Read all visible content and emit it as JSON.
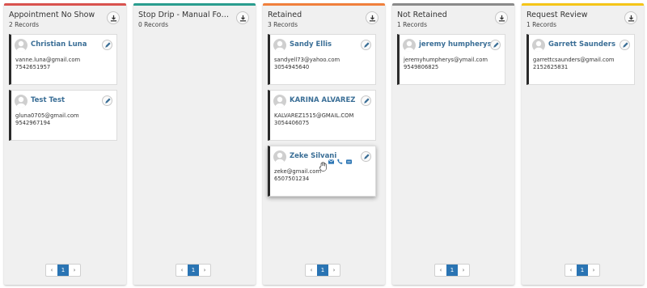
{
  "columns": [
    {
      "title": "Appointment No Show",
      "count": "2 Records",
      "color": "#d9534f",
      "cards": [
        {
          "name": "Christian Luna",
          "email": "vanne.luna@gmail.com",
          "phone": "7542651957"
        },
        {
          "name": "Test Test",
          "email": "gluna0705@gmail.com",
          "phone": "9542967194"
        }
      ],
      "pager": {
        "prev": "‹",
        "page": "1",
        "next": "›"
      }
    },
    {
      "title": "Stop Drip - Manual Follow ...",
      "count": "0 Records",
      "color": "#2a9d8f",
      "cards": [],
      "pager": {
        "prev": "‹",
        "page": "1",
        "next": "›"
      }
    },
    {
      "title": "Retained",
      "count": "3 Records",
      "color": "#f0803c",
      "cards": [
        {
          "name": "Sandy Ellis",
          "email": "sandyell73@yahoo.com",
          "phone": "3054945640"
        },
        {
          "name": "KARINA ALVAREZ",
          "email": "KALVAREZ1515@GMAIL.COM",
          "phone": "3054406075"
        },
        {
          "name": "Zeke Silvani",
          "email": "zeke@gmail.com",
          "phone": "6507501234"
        }
      ],
      "pager": {
        "prev": "‹",
        "page": "1",
        "next": "›"
      }
    },
    {
      "title": "Not Retained",
      "count": "1 Records",
      "color": "#8a8a8a",
      "cards": [
        {
          "name": "jeremy humpherys",
          "email": "jeremyhumpherys@ymail.com",
          "phone": "9549806825"
        }
      ],
      "pager": {
        "prev": "‹",
        "page": "1",
        "next": "›"
      }
    },
    {
      "title": "Request Review",
      "count": "1 Records",
      "color": "#f5c518",
      "cards": [
        {
          "name": "Garrett Saunders",
          "email": "garrettcsaunders@gmail.com",
          "phone": "2152625831"
        }
      ],
      "pager": {
        "prev": "‹",
        "page": "1",
        "next": "›"
      }
    }
  ],
  "icons": {
    "download": "download-icon",
    "edit": "pencil-icon",
    "email": "envelope-icon",
    "call": "phone-icon",
    "sms": "message-icon",
    "avatar": "user-avatar-icon"
  },
  "colors": {
    "link": "#3a6e96",
    "pager_active": "#2a74b3",
    "card_accent": "#2a2a2a"
  }
}
